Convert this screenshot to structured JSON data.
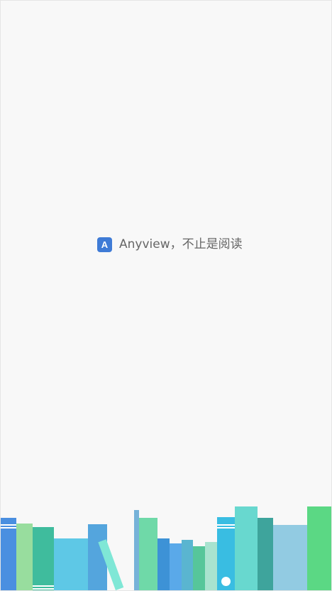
{
  "splash": {
    "logo_letter": "A",
    "tagline": "Anyview，不止是阅读"
  },
  "colors": {
    "background": "#f8f8f8",
    "logo": "#3f7bd6",
    "text": "#666666"
  },
  "illustration": {
    "icon": "bookshelf-illustration"
  }
}
